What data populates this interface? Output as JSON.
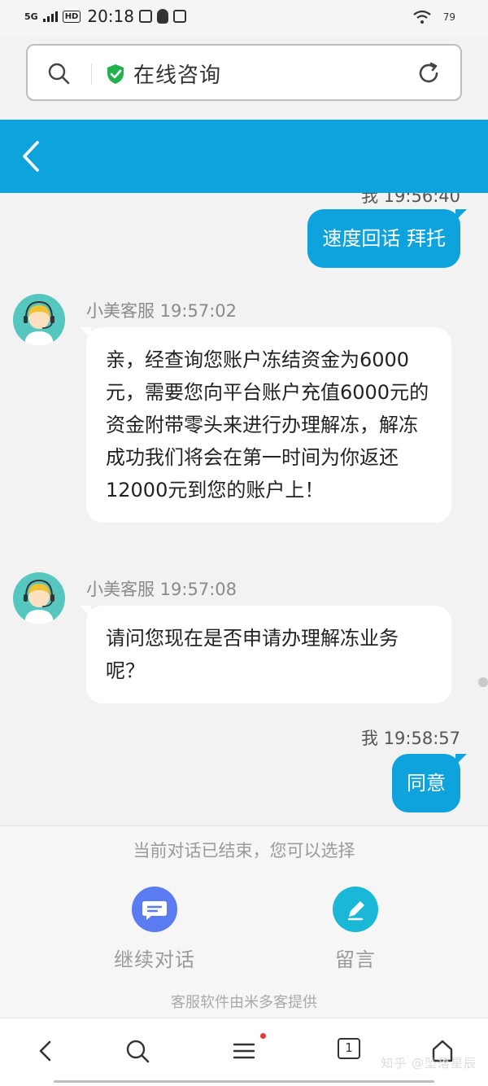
{
  "status_bar": {
    "signal": "5G",
    "hd": "HD",
    "time": "20:18",
    "battery": "79"
  },
  "url_bar": {
    "title": "在线咨询"
  },
  "chat": {
    "partial_top_time": "我 19:56:40",
    "messages": [
      {
        "from": "me",
        "text": "速度回话 拜托"
      },
      {
        "from": "agent",
        "meta": "小美客服 19:57:02",
        "text": "亲，经查询您账户冻结资金为6000元，需要您向平台账户充值6000元的资金附带零头来进行办理解冻，解冻成功我们将会在第一时间为你返还12000元到您的账户上！"
      },
      {
        "from": "agent",
        "meta": "小美客服 19:57:08",
        "text": "请问您现在是否申请办理解冻业务呢？"
      },
      {
        "from": "me",
        "meta": "我 19:58:57",
        "text": "同意"
      }
    ]
  },
  "footer": {
    "end_note": "当前对话已结束，您可以选择",
    "continue_label": "继续对话",
    "message_label": "留言",
    "powered_by": "客服软件由米多客提供",
    "continue_color": "#5b7cf0",
    "message_color": "#1ab8d6"
  },
  "nav": {
    "tab_count": "1"
  },
  "watermark": "知乎 @坠落星辰",
  "colors": {
    "accent": "#0fa3dd",
    "shield": "#22b14c"
  }
}
